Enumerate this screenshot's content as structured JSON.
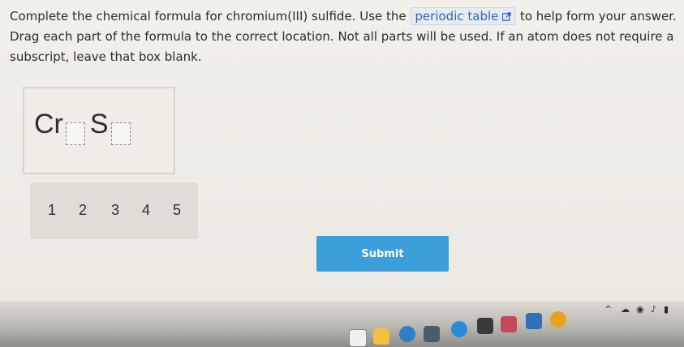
{
  "question": {
    "line1_before": "Complete the chemical formula for chromium(III) sulfide. Use the",
    "link_text": "periodic table",
    "line1_after": "to help form your answer.",
    "line2": "Drag each part of the formula to the correct location. Not all parts will be used. If an atom does not require a subscript, leave that box blank."
  },
  "formula": {
    "element1": "Cr",
    "element2": "S"
  },
  "tray": {
    "items": [
      "1",
      "2",
      "3",
      "4",
      "5"
    ]
  },
  "submit_label": "Submit",
  "colors": {
    "link": "#3767a8",
    "submit_bg": "#3d9fd9"
  },
  "taskbar": {
    "icons": [
      "file-explorer-icon",
      "folder-icon",
      "browser-icon",
      "calculator-icon",
      "chrome-icon",
      "calendar-icon",
      "office-icon",
      "stocks-icon",
      "shield-icon"
    ],
    "tray_icons": [
      "chevron-up-icon",
      "cloud-icon",
      "wifi-icon",
      "volume-icon",
      "battery-icon"
    ]
  }
}
